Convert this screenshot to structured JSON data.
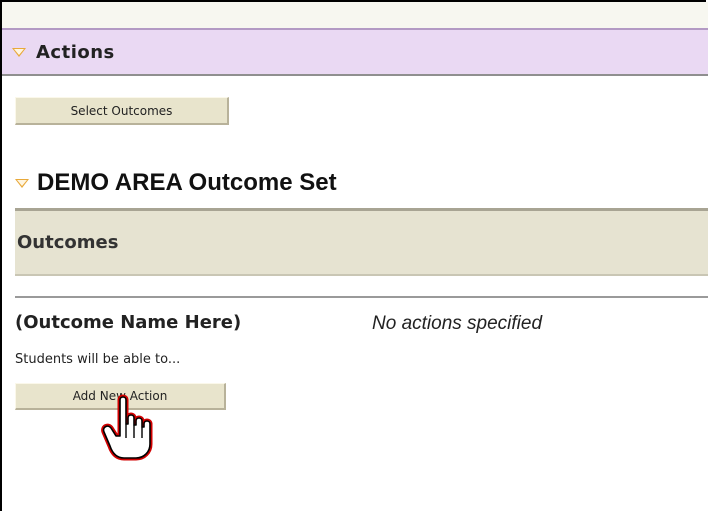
{
  "actions_section": {
    "title": "Actions",
    "select_outcomes_label": "Select Outcomes"
  },
  "outcome_set": {
    "title": "DEMO AREA Outcome Set"
  },
  "outcomes_panel": {
    "header": "Outcomes",
    "items": [
      {
        "name": "(Outcome Name Here)",
        "actions_status": "No actions specified",
        "description": "Students will be able to...",
        "add_action_label": "Add New Action"
      }
    ]
  },
  "colors": {
    "actions_bar_bg": "#ead9f3",
    "outcomes_header_bg": "#e6e3d1",
    "button_bg": "#e8e4cc",
    "triangle": "#e8a93a",
    "cursor_outline": "#d10000"
  },
  "icons": [
    "collapse-triangle-icon",
    "hand-pointer-cursor-icon"
  ]
}
